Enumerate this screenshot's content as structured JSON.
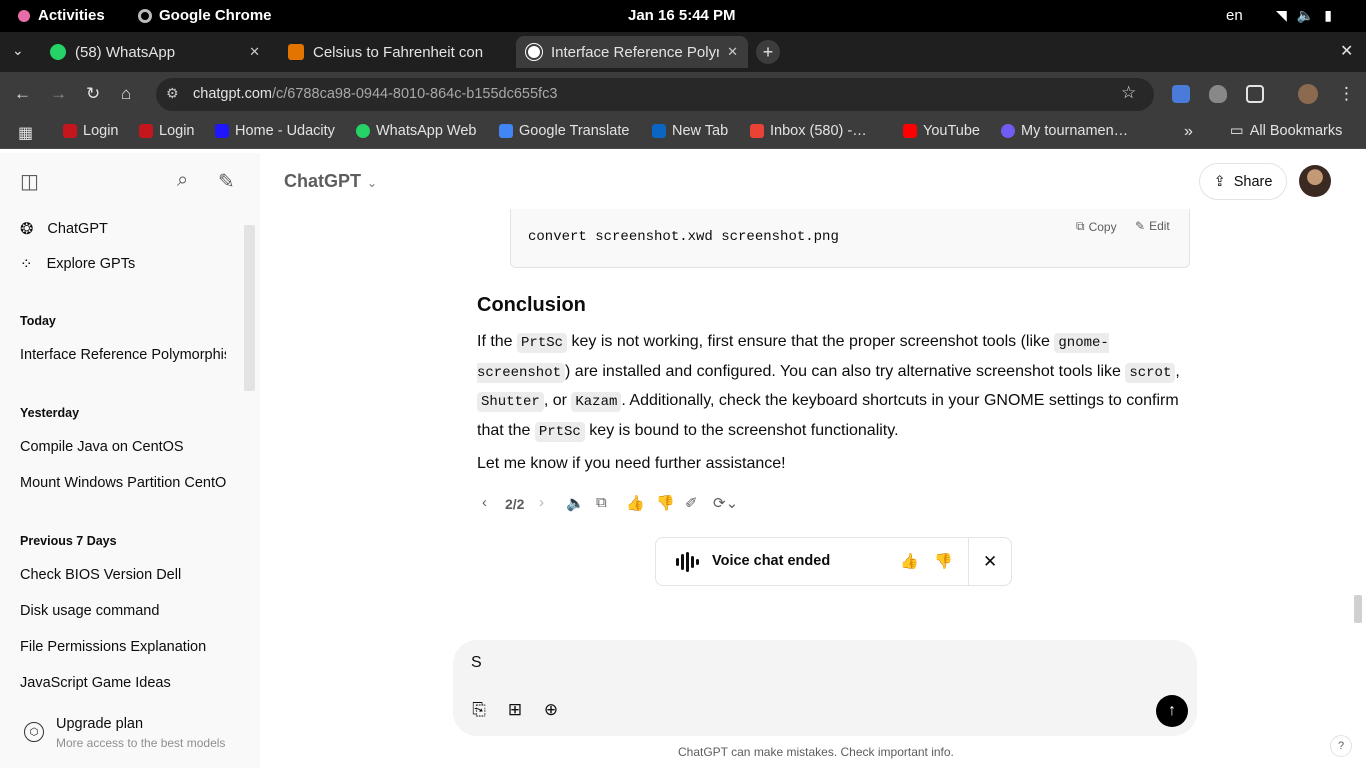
{
  "system": {
    "activities": "Activities",
    "app_name": "Google Chrome",
    "clock": "Jan 16  5:44 PM",
    "lang": "en"
  },
  "tabs": [
    {
      "title": "(58) WhatsApp",
      "icon": "whatsapp-icon"
    },
    {
      "title": "Celsius to Fahrenheit con",
      "icon": "converter-icon"
    },
    {
      "title": "Interface Reference Polyn",
      "icon": "chatgpt-icon"
    }
  ],
  "address": {
    "host": "chatgpt.com",
    "path": "/c/6788ca98-0944-8010-864c-b155dc655fc3"
  },
  "bookmarks": [
    {
      "label": "Login",
      "color": "#c4161c"
    },
    {
      "label": "Login",
      "color": "#c4161c"
    },
    {
      "label": "Home - Udacity",
      "color": "#2015ff"
    },
    {
      "label": "WhatsApp Web",
      "color": "#25d366"
    },
    {
      "label": "Google Translate",
      "color": "#4285f4"
    },
    {
      "label": "New Tab",
      "color": "#0a66c2"
    },
    {
      "label": "Inbox (580) -…",
      "color": "#ea4335"
    },
    {
      "label": "YouTube",
      "color": "#ff0000"
    },
    {
      "label": "My tournamen…",
      "color": "#6f5cf1"
    }
  ],
  "all_bookmarks": "All Bookmarks",
  "sidebar": {
    "top_items": [
      {
        "label": "ChatGPT",
        "icon": "chatgpt-icon"
      },
      {
        "label": "Explore GPTs",
        "icon": "grid-icon"
      }
    ],
    "sections": [
      {
        "heading": "Today",
        "items": [
          "Interface Reference Polymorphism"
        ]
      },
      {
        "heading": "Yesterday",
        "items": [
          "Compile Java on CentOS",
          "Mount Windows Partition CentOS"
        ]
      },
      {
        "heading": "Previous 7 Days",
        "items": [
          "Check BIOS Version Dell",
          "Disk usage command",
          "File Permissions Explanation",
          "JavaScript Game Ideas"
        ]
      }
    ],
    "upgrade_title": "Upgrade plan",
    "upgrade_subtitle": "More access to the best models"
  },
  "header": {
    "model": "ChatGPT",
    "share": "Share"
  },
  "code_block": {
    "code": "convert screenshot.xwd screenshot.png",
    "copy": "Copy",
    "edit": "Edit"
  },
  "conclusion": {
    "heading": "Conclusion",
    "p1": [
      {
        "t": "If the "
      },
      {
        "c": "PrtSc"
      },
      {
        "t": " key is not working, first ensure that the proper screenshot tools (like "
      },
      {
        "c": "gnome-screenshot"
      },
      {
        "t": ") are installed and configured. You can also try alternative screenshot tools like "
      },
      {
        "c": "scrot"
      },
      {
        "t": ", "
      },
      {
        "c": "Shutter"
      },
      {
        "t": ", or "
      },
      {
        "c": "Kazam"
      },
      {
        "t": ". Additionally, check the keyboard shortcuts in your GNOME settings to confirm that the "
      },
      {
        "c": "PrtSc"
      },
      {
        "t": " key is bound to the screenshot functionality."
      }
    ],
    "p2": "Let me know if you need further assistance!"
  },
  "pager": "2/2",
  "voice_banner": "Voice chat ended",
  "composer": {
    "value": "S"
  },
  "disclaimer": "ChatGPT can make mistakes. Check important info.",
  "help": "?"
}
